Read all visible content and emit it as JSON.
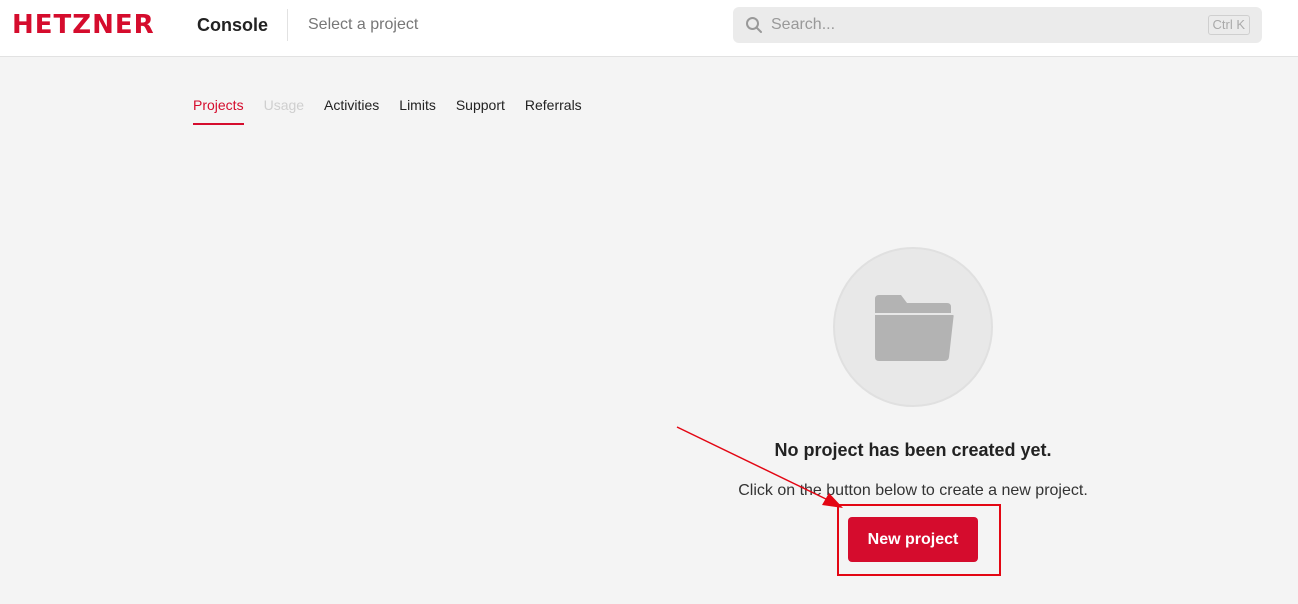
{
  "header": {
    "logo": "HETZNER",
    "app_name": "Console",
    "project_select": "Select a project",
    "search": {
      "placeholder": "Search...",
      "shortcut": "Ctrl K",
      "icon": "search-icon"
    }
  },
  "tabs": [
    {
      "label": "Projects",
      "state": "active"
    },
    {
      "label": "Usage",
      "state": "disabled"
    },
    {
      "label": "Activities",
      "state": "normal"
    },
    {
      "label": "Limits",
      "state": "normal"
    },
    {
      "label": "Support",
      "state": "normal"
    },
    {
      "label": "Referrals",
      "state": "normal"
    }
  ],
  "empty_state": {
    "icon": "folder-icon",
    "title": "No project has been created yet.",
    "subtitle": "Click on the button below to create a new project.",
    "button_label": "New project"
  },
  "colors": {
    "brand": "#d50c2d",
    "annotation": "#e30613",
    "background": "#f4f4f4"
  }
}
